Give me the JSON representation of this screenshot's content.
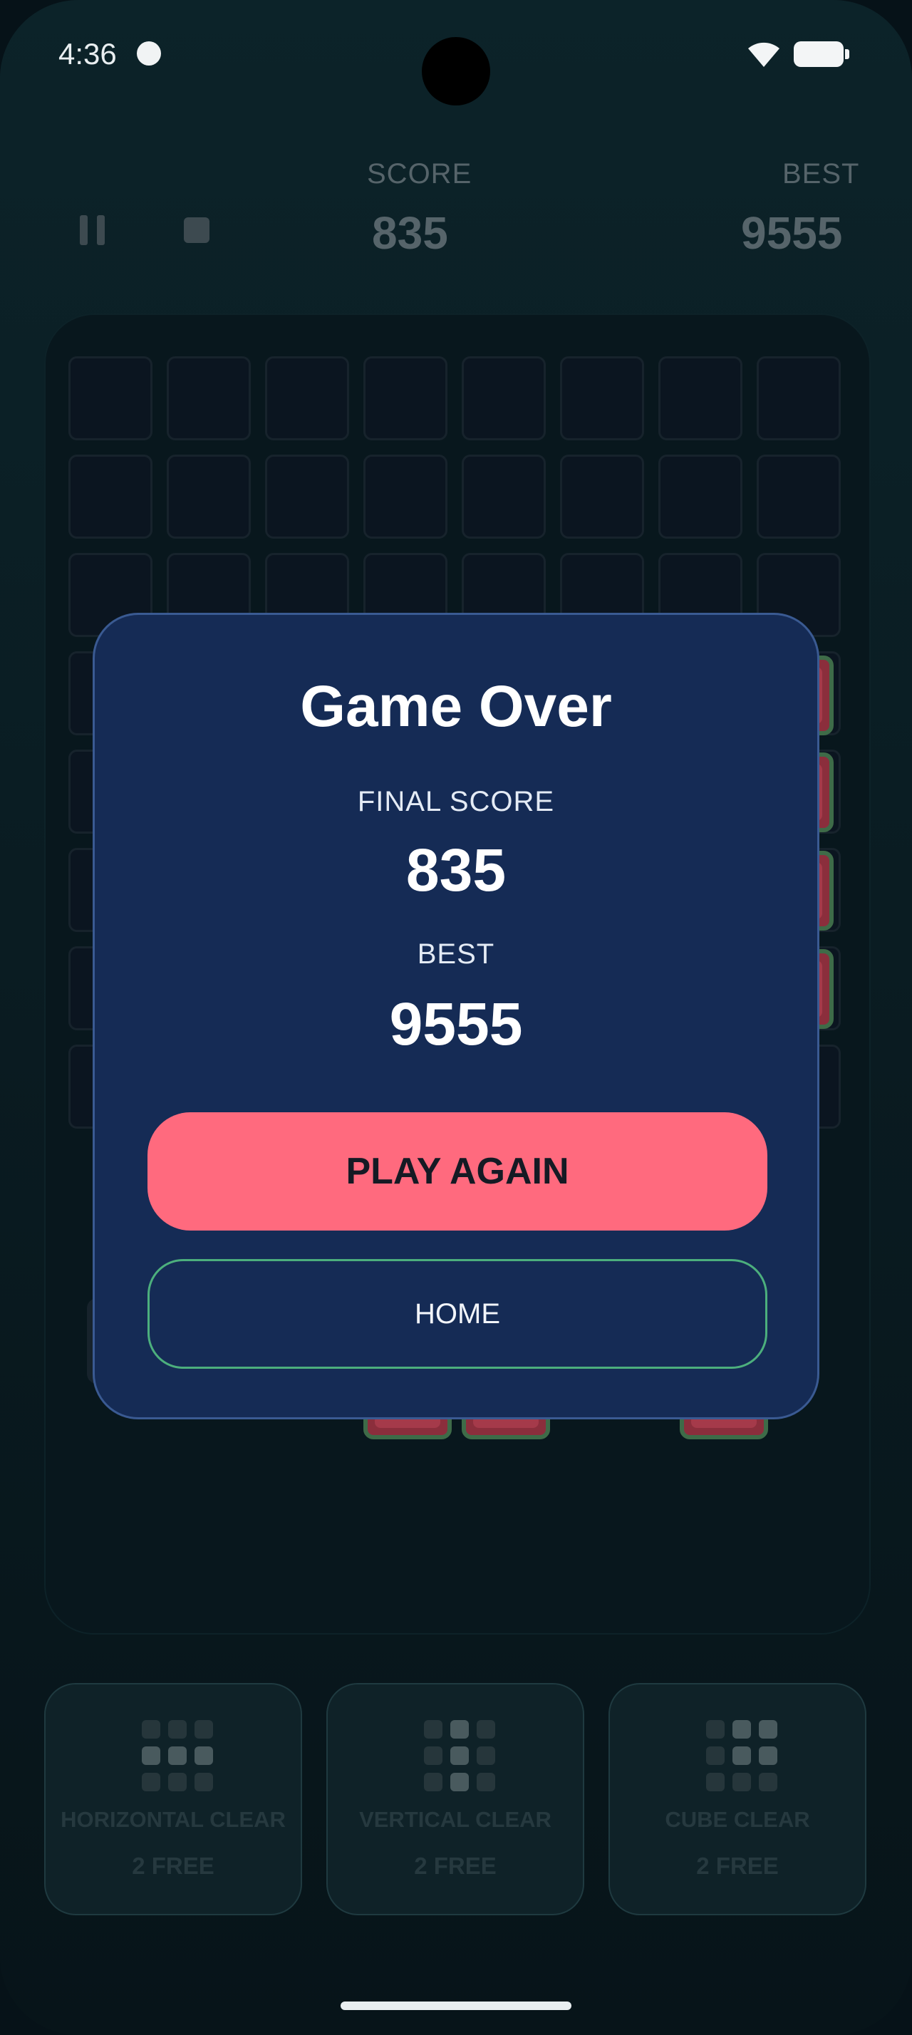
{
  "status_bar": {
    "time": "4:36"
  },
  "top_bar": {
    "score_label": "SCORE",
    "score_value": "835",
    "best_label": "BEST",
    "best_value": "9555"
  },
  "power_ups": [
    {
      "name": "HORIZONTAL CLEAR",
      "count": "2 FREE"
    },
    {
      "name": "VERTICAL CLEAR",
      "count": "2 FREE"
    },
    {
      "name": "CUBE CLEAR",
      "count": "2 FREE"
    }
  ],
  "modal": {
    "title": "Game Over",
    "final_score_label": "FINAL SCORE",
    "final_score_value": "835",
    "best_label": "BEST",
    "best_value": "9555",
    "play_again_label": "PLAY AGAIN",
    "home_label": "HOME"
  },
  "colors": {
    "accent_play": "#ff6a7e",
    "accent_home_border": "#4caf7d",
    "modal_bg": "#152b55"
  }
}
